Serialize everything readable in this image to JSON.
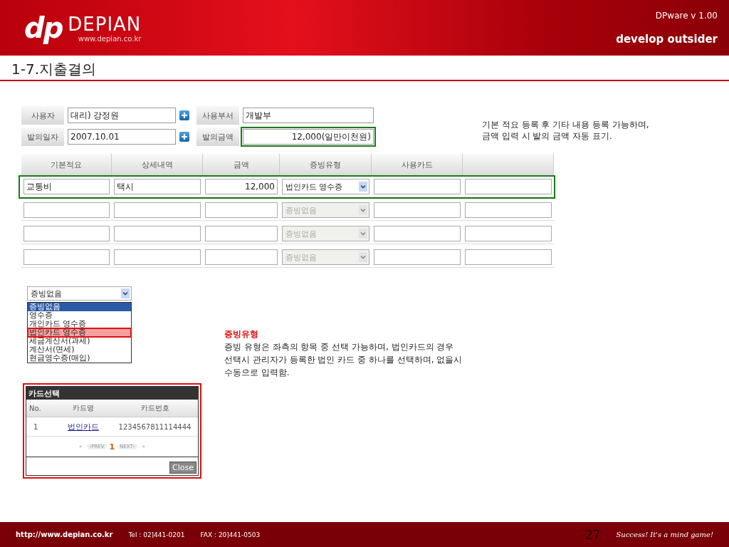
{
  "header": {
    "logo_mark": "dp",
    "logo_name": "DEPIAN",
    "logo_url": "www.depian.co.kr",
    "version": "DPware v 1.00",
    "tagline": "develop outsider"
  },
  "page_title": "1-7.지출결의",
  "form": {
    "fields": [
      {
        "label": "사용자",
        "value": "대리) 강정원",
        "kind": "text",
        "lookup": true,
        "highlighted": false
      },
      {
        "label": "사용부서",
        "value": "개발부",
        "kind": "text",
        "lookup": false,
        "highlighted": false
      },
      {
        "label": "발의일자",
        "value": "2007.10.01",
        "kind": "text",
        "lookup": true,
        "highlighted": false
      },
      {
        "label": "발의금액",
        "value": "12,000(일만이천원)",
        "kind": "amount",
        "lookup": false,
        "highlighted": true
      }
    ]
  },
  "note": {
    "lines": [
      "기본 적요 등록 후 기타 내용 등록 가능하며,",
      "금액 입력 시 발의 금액 자동 표기."
    ]
  },
  "table": {
    "columns": [
      "기본적요",
      "상세내역",
      "금액",
      "증빙유형",
      "사용카드"
    ],
    "rows": [
      {
        "highlighted": true,
        "cells": [
          {
            "kind": "text",
            "value": "교통비"
          },
          {
            "kind": "text",
            "value": "택시"
          },
          {
            "kind": "amount",
            "value": "12,000"
          },
          {
            "kind": "select",
            "value": "법인카드 영수증",
            "disabled": false
          },
          {
            "kind": "text"
          },
          {
            "kind": "text"
          }
        ]
      },
      {
        "highlighted": false,
        "cells": [
          {
            "kind": "text"
          },
          {
            "kind": "text"
          },
          {
            "kind": "amount"
          },
          {
            "kind": "select",
            "value": "증빙없음",
            "disabled": true
          },
          {
            "kind": "text"
          },
          {
            "kind": "text"
          }
        ]
      },
      {
        "highlighted": false,
        "cells": [
          {
            "kind": "text"
          },
          {
            "kind": "text"
          },
          {
            "kind": "amount"
          },
          {
            "kind": "select",
            "value": "증빙없음",
            "disabled": true
          },
          {
            "kind": "text"
          },
          {
            "kind": "text"
          }
        ]
      },
      {
        "highlighted": false,
        "cells": [
          {
            "kind": "text"
          },
          {
            "kind": "text"
          },
          {
            "kind": "amount"
          },
          {
            "kind": "select",
            "value": "증빙없음",
            "disabled": true
          },
          {
            "kind": "text"
          },
          {
            "kind": "text"
          }
        ]
      }
    ]
  },
  "dropdown": {
    "value": "증빙없음",
    "options": [
      {
        "label": "증빙없음",
        "selected": true,
        "marked": false
      },
      {
        "label": "영수증",
        "selected": false,
        "marked": false
      },
      {
        "label": "개인카드 영수증",
        "selected": false,
        "marked": false
      },
      {
        "label": "법인카드 영수증",
        "selected": false,
        "marked": true
      },
      {
        "label": "세금계산서(과세)",
        "selected": false,
        "marked": false
      },
      {
        "label": "계산서(면세)",
        "selected": false,
        "marked": false
      },
      {
        "label": "현금영수증(매입)",
        "selected": false,
        "marked": false
      }
    ]
  },
  "explanation": {
    "title": "증빙유형",
    "lines": [
      "증빙 유형은 좌측의 항목 중 선택 가능하며, 법인카드의 경우",
      "선택시 관리자가 등록한 법인 카드 중 하나를 선택하며, 없을시",
      "수동으로 입력함."
    ]
  },
  "card_popup": {
    "title": "카드선택",
    "columns": [
      "No.",
      "카드명",
      "카드번호"
    ],
    "rows": [
      {
        "no": "1",
        "name": "법인카드",
        "number": "1234567811114444"
      }
    ],
    "pagination": {
      "first": "«",
      "prev": "‹PREV",
      "page": "1",
      "next": "NEXT›",
      "last": "»"
    },
    "close": "Close"
  },
  "footer": {
    "url": "http://www.depian.co.kr",
    "tel": "Tel : 02]441-0201",
    "fax": "FAX : 20]441-0503",
    "page": "27",
    "slogan": "Success! It's a mind game!"
  }
}
